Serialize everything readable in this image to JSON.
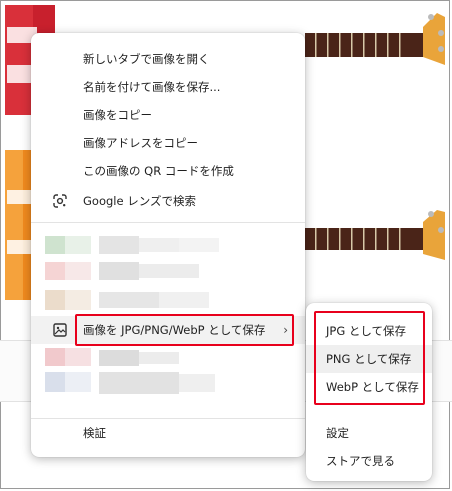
{
  "context_menu": {
    "items": [
      {
        "label": "新しいタブで画像を開く"
      },
      {
        "label": "名前を付けて画像を保存..."
      },
      {
        "label": "画像をコピー"
      },
      {
        "label": "画像アドレスをコピー"
      },
      {
        "label": "この画像の QR コードを作成"
      },
      {
        "label": "Google レンズで検索",
        "icon": "google-lens-icon"
      }
    ],
    "extension_item": {
      "label": "画像を JPG/PNG/WebP として保存",
      "icon": "image-icon",
      "arrow": "›"
    },
    "inspect": {
      "label": "検証"
    }
  },
  "submenu": {
    "items": [
      {
        "label": "JPG として保存"
      },
      {
        "label": "PNG として保存"
      },
      {
        "label": "WebP として保存"
      },
      {
        "label": "設定"
      },
      {
        "label": "ストアで見る"
      }
    ]
  },
  "colors": {
    "highlight": "#e8001c",
    "guitar_red": "#c8202d",
    "guitar_orange": "#f08a1e",
    "fretboard": "#4a2418"
  }
}
